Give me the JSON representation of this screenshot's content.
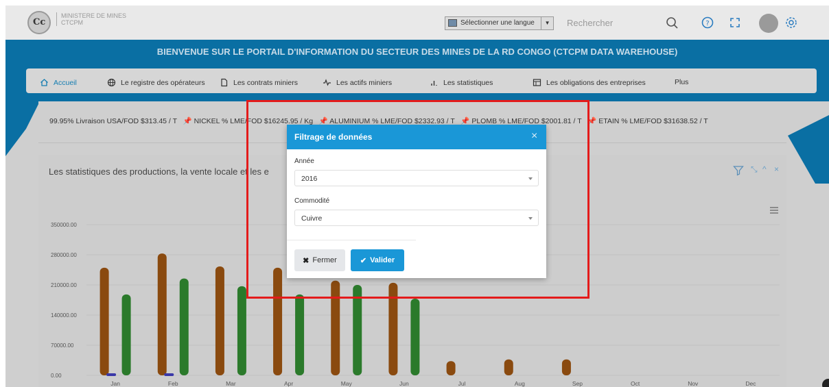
{
  "header": {
    "org_line1": "MINISTERE DE MINES",
    "org_line2": "CTCPM",
    "logo_text": "Cc",
    "language_select": "Sélectionner une langue",
    "language_arrow": "▼",
    "search_placeholder": "Rechercher",
    "icons": [
      "search-icon",
      "help-icon",
      "fullscreen-icon",
      "avatar",
      "settings-icon"
    ]
  },
  "banner": {
    "title": "BIENVENUE SUR LE PORTAIL D'INFORMATION DU SECTEUR DES MINES DE LA RD CONGO (CTCPM DATA WAREHOUSE)"
  },
  "nav": {
    "items": [
      {
        "label": "Accueil",
        "icon": "home-icon",
        "active": true
      },
      {
        "label": "Le registre des opérateurs",
        "icon": "globe-icon"
      },
      {
        "label": "Les contrats miniers",
        "icon": "document-icon"
      },
      {
        "label": "Les actifs miniers",
        "icon": "activity-icon"
      },
      {
        "label": "Les statistiques",
        "icon": "bar-chart-icon"
      },
      {
        "label": "Les obligations des entreprises",
        "icon": "table-icon"
      },
      {
        "label": "Plus",
        "icon": ""
      }
    ]
  },
  "ticker": {
    "segments": [
      "99.95% Livraison USA/FOD $313.45 / T",
      "NICKEL % LME/FOD $16245.95 / Kg",
      "ALUMINIUM % LME/FOD $2332.93 / T",
      "PLOMB % LME/FOD $2001.81 / T",
      "ETAIN % LME/FOD $31638.52 / T"
    ]
  },
  "chart_panel": {
    "title": "Les statistiques des productions, la vente locale et les e"
  },
  "chart_data": {
    "type": "bar",
    "categories": [
      "Jan",
      "Feb",
      "Mar",
      "Apr",
      "May",
      "Jun",
      "Jul",
      "Aug",
      "Sep",
      "Oct",
      "Nov",
      "Dec"
    ],
    "y_ticks": [
      "350000.00",
      "280000.00",
      "210000.00",
      "140000.00",
      "70000.00",
      "0.00"
    ],
    "ylim": [
      0,
      350000
    ],
    "series": [
      {
        "color": "#8a4a0f",
        "values": [
          250000,
          283000,
          253000,
          250000,
          220000,
          215000,
          33000,
          37000,
          37000,
          0,
          0,
          0
        ]
      },
      {
        "color": "#2b7a2b",
        "values": [
          188000,
          225000,
          207000,
          188000,
          210000,
          178000,
          0,
          0,
          0,
          0,
          0,
          0
        ]
      },
      {
        "color": "#3a38a8",
        "values": [
          3000,
          2500,
          0,
          0,
          0,
          0,
          0,
          0,
          0,
          0,
          0,
          0
        ]
      }
    ]
  },
  "modal": {
    "title": "Filtrage de données",
    "close_glyph": "×",
    "year_label": "Année",
    "year_value": "2016",
    "commodity_label": "Commodité",
    "commodity_value": "Cuivre",
    "cancel_label": "Fermer",
    "submit_label": "Valider",
    "highlight_color": "#e41b1b",
    "accent_color": "#1a97d7"
  }
}
